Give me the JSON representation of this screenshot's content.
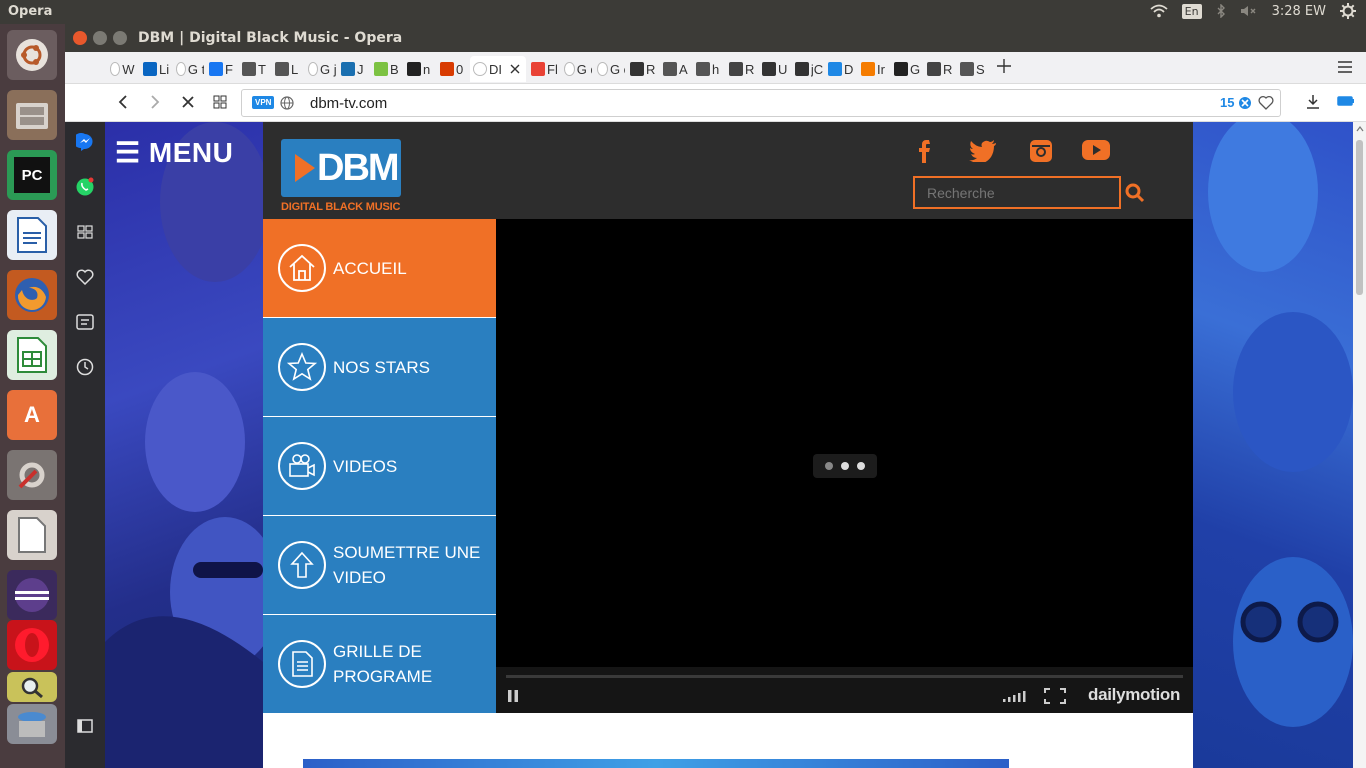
{
  "top_panel": {
    "app_name": "Opera",
    "lang": "En",
    "time": "3:28 EW"
  },
  "window": {
    "title": "DBM | Digital Black Music - Opera"
  },
  "tabs": [
    {
      "label": "W L",
      "favicon": "wikipedia-icon",
      "color": "#ffffff"
    },
    {
      "label": "Li",
      "favicon": "linkedin-icon",
      "color": "#0a66c2"
    },
    {
      "label": "G te",
      "favicon": "google-icon",
      "color": "#ffffff"
    },
    {
      "label": "F",
      "favicon": "facebook-icon",
      "color": "#1877f2"
    },
    {
      "label": "T",
      "favicon": "document-icon",
      "color": "#555555"
    },
    {
      "label": "L",
      "favicon": "document-icon",
      "color": "#555555"
    },
    {
      "label": "G je",
      "favicon": "google-icon",
      "color": "#ffffff"
    },
    {
      "label": "J",
      "favicon": "puzzle-icon",
      "color": "#1a6fb0"
    },
    {
      "label": "B",
      "favicon": "chart-icon",
      "color": "#7cc242"
    },
    {
      "label": "n",
      "favicon": "github-icon",
      "color": "#222222"
    },
    {
      "label": "0",
      "favicon": "office-icon",
      "color": "#d83b01"
    },
    {
      "label": "DI",
      "favicon": "loading-icon",
      "color": "#ffffff"
    },
    {
      "label": "Fl",
      "favicon": "grid-icon",
      "color": "#e94235"
    },
    {
      "label": "G d",
      "favicon": "google-icon",
      "color": "#ffffff"
    },
    {
      "label": "G c",
      "favicon": "google-icon",
      "color": "#ffffff"
    },
    {
      "label": "R",
      "favicon": "codepen-icon",
      "color": "#333333"
    },
    {
      "label": "A",
      "favicon": "document-icon",
      "color": "#555555"
    },
    {
      "label": "h",
      "favicon": "document-icon",
      "color": "#555555"
    },
    {
      "label": "R",
      "favicon": "avatar-icon",
      "color": "#444444"
    },
    {
      "label": "U",
      "favicon": "swirl-icon",
      "color": "#333333"
    },
    {
      "label": "jC",
      "favicon": "swirl-icon",
      "color": "#333333"
    },
    {
      "label": "D",
      "favicon": "d-icon",
      "color": "#1e88e5"
    },
    {
      "label": "Ir",
      "favicon": "bird-icon",
      "color": "#f57c00"
    },
    {
      "label": "G",
      "favicon": "github-icon",
      "color": "#222222"
    },
    {
      "label": "R",
      "favicon": "avatar-icon",
      "color": "#444444"
    },
    {
      "label": "S",
      "favicon": "grid-icon",
      "color": "#555555"
    }
  ],
  "addressbar": {
    "vpn": "VPN",
    "url": "dbm-tv.com",
    "badge_count": "15"
  },
  "site": {
    "menu_label": "☰ MENU",
    "logo_text": "DBM",
    "logo_subtitle": "DIGITAL BLACK MUSIC",
    "search_placeholder": "Recherche",
    "nav": [
      {
        "line1": "ACCUEIL",
        "line2": "",
        "icon": "home-icon",
        "active": true
      },
      {
        "line1": "NOS STARS",
        "line2": "",
        "icon": "star-icon",
        "active": false
      },
      {
        "line1": "VIDEOS",
        "line2": "",
        "icon": "video-camera-icon",
        "active": false
      },
      {
        "line1": "SOUMETTRE UNE",
        "line2": "VIDEO",
        "icon": "upload-arrow-icon",
        "active": false
      },
      {
        "line1": "GRILLE DE",
        "line2": "PROGRAME",
        "icon": "document-icon",
        "active": false
      }
    ],
    "player_brand": "dailymotion",
    "accent": "#f07026",
    "nav_blue": "#2a7fc0"
  }
}
